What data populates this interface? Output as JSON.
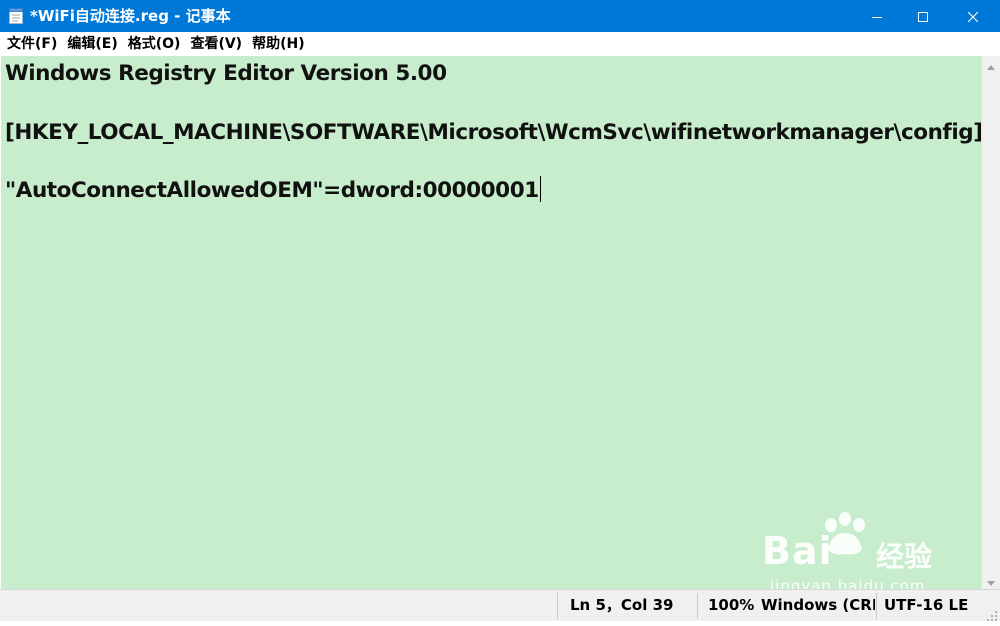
{
  "window": {
    "title": "*WiFi自动连接.reg - 记事本",
    "accent_color": "#0078d7",
    "editor_background": "#c7edcc",
    "controls": [
      "minimize-icon",
      "maximize-icon",
      "close-icon"
    ]
  },
  "menu": {
    "items": [
      {
        "label": "文件(F)"
      },
      {
        "label": "编辑(E)"
      },
      {
        "label": "格式(O)"
      },
      {
        "label": "查看(V)"
      },
      {
        "label": "帮助(H)"
      }
    ]
  },
  "editor": {
    "lines": [
      "Windows Registry Editor Version 5.00",
      "",
      "[HKEY_LOCAL_MACHINE\\SOFTWARE\\Microsoft\\WcmSvc\\wifinetworkmanager\\config]",
      "",
      "\"AutoConnectAllowedOEM\"=dword:00000001"
    ]
  },
  "status": {
    "position": "Ln 5，Col 39",
    "zoom": "100%",
    "line_ending": "Windows (CRLF)",
    "encoding": "UTF-16 LE"
  },
  "watermark": {
    "brand": "Bai",
    "brand_suffix": "经验",
    "url": "jingyan.baidu.com"
  }
}
